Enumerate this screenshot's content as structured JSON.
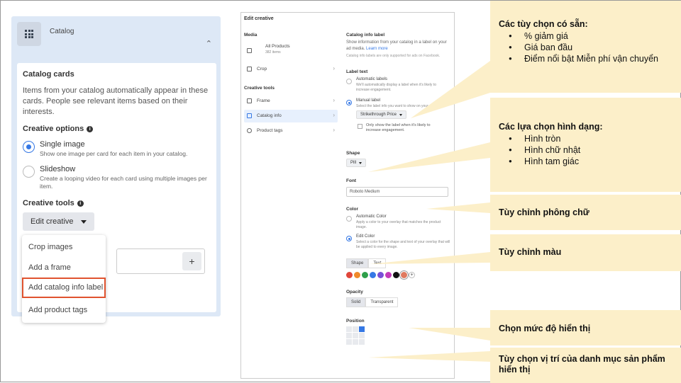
{
  "left": {
    "catalog_title": "Catalog",
    "cards_title": "Catalog cards",
    "cards_desc": "Items from your catalog automatically appear in these cards. People see relevant items based on their interests.",
    "creative_options_title": "Creative options",
    "option1_name": "Single image",
    "option1_desc": "Show one image per card for each item in your catalog.",
    "option2_name": "Slideshow",
    "option2_desc": "Create a looping video for each card using multiple images per item.",
    "creative_tools_title": "Creative tools",
    "edit_creative_label": "Edit creative",
    "dropdown": [
      "Crop images",
      "Add a frame",
      "Add catalog info label",
      "Add product tags"
    ]
  },
  "mid": {
    "title": "Edit creative",
    "media_title": "Media",
    "all_products": "All Products",
    "items_count": "382 items",
    "crop": "Crop",
    "creative_tools": "Creative tools",
    "frame": "Frame",
    "catalog_info": "Catalog info",
    "product_tags": "Product tags",
    "label_title": "Catalog info label",
    "label_desc": "Show information from your catalog in a label on your ad media.",
    "learn_more": "Learn more",
    "label_note": "Catalog info labels are only supported for ads on Facebook.",
    "label_text": "Label text",
    "auto_labels": "Automatic labels",
    "auto_labels_desc": "We'll automatically display a label when it's likely to increase engagement.",
    "manual_label": "Manual label",
    "manual_label_desc": "Select the label info you want to show on your ad.",
    "strikethrough": "Strikethrough Price",
    "only_show": "Only show the label when it's likely to increase engagement.",
    "shape": "Shape",
    "pill": "Pill",
    "font": "Font",
    "font_value": "Roboto Medium",
    "color": "Color",
    "auto_color": "Automatic Color",
    "auto_color_desc": "Apply a color to your overlay that matches the product image.",
    "edit_color": "Edit Color",
    "edit_color_desc": "Select a color for the shape and text of your overlay that will be applied to every image.",
    "shape_tab": "Shape",
    "text_tab": "Text",
    "swatches": [
      "#e0463a",
      "#f08a2a",
      "#2e9f4a",
      "#3578e5",
      "#7a4fd6",
      "#c43ab8",
      "#111111",
      "#e07a5f"
    ],
    "opacity": "Opacity",
    "solid": "Solid",
    "transparent": "Transparent",
    "position": "Position"
  },
  "callouts": {
    "c1_title": "Các tùy chọn có sẵn:",
    "c1_items": [
      "% giảm giá",
      "Giá ban đầu",
      "Điểm nổi bật Miễn phí vận chuyển"
    ],
    "c2_title": "Các lựa chọn hình dạng:",
    "c2_items": [
      "Hình tròn",
      "Hình chữ nhật",
      "Hình tam giác"
    ],
    "c3": "Tùy chỉnh phông chữ",
    "c4": "Tùy chỉnh màu",
    "c5": "Chọn mức độ hiển thị",
    "c6": "Tùy chọn vị trí của danh mục sản phẩm hiển thị"
  },
  "colors": {
    "callout_bg": "#fcefc9",
    "accent": "#3578e5",
    "highlight": "#e0532f",
    "panel_bg": "#dde8f6"
  }
}
